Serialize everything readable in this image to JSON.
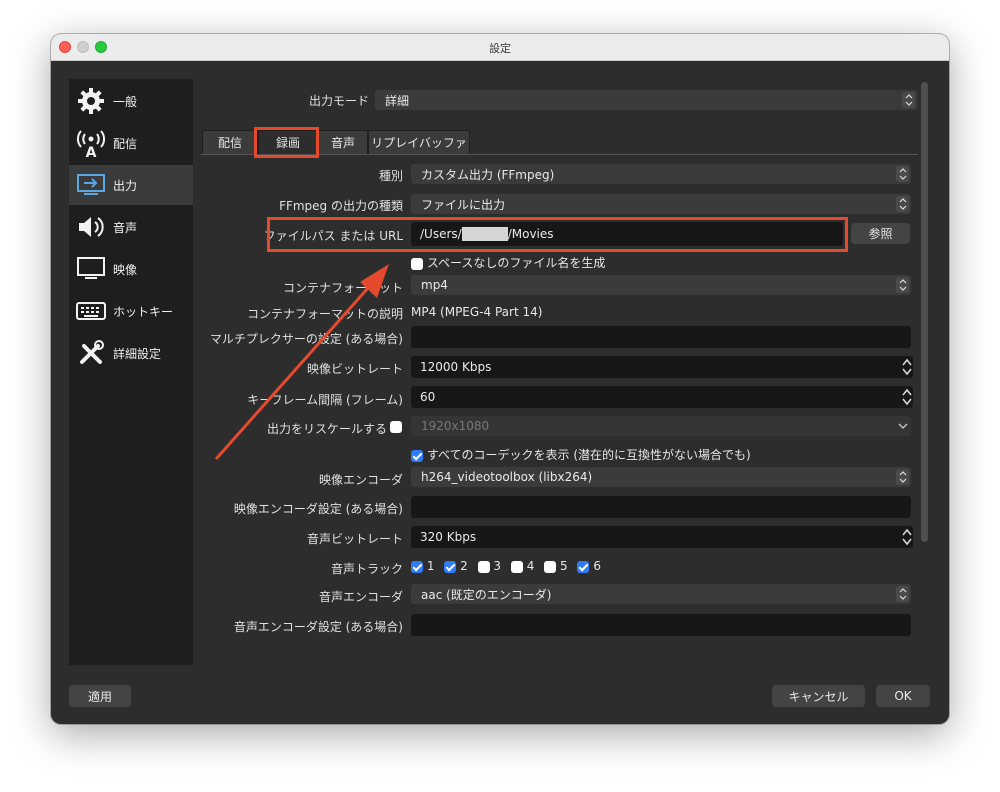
{
  "window": {
    "title": "設定"
  },
  "sidebar": {
    "items": [
      {
        "label": "一般",
        "icon": "gear-icon"
      },
      {
        "label": "配信",
        "icon": "antenna-icon"
      },
      {
        "label": "出力",
        "icon": "output-icon"
      },
      {
        "label": "音声",
        "icon": "speaker-icon"
      },
      {
        "label": "映像",
        "icon": "monitor-icon"
      },
      {
        "label": "ホットキー",
        "icon": "keyboard-icon"
      },
      {
        "label": "詳細設定",
        "icon": "tools-icon"
      }
    ],
    "active_index": 2
  },
  "output_mode": {
    "label": "出力モード",
    "value": "詳細"
  },
  "tabs": [
    "配信",
    "録画",
    "音声",
    "リプレイバッファ"
  ],
  "active_tab": "録画",
  "form": {
    "type": {
      "label": "種別",
      "value": "カスタム出力 (FFmpeg)"
    },
    "ffmpeg_output_type": {
      "label": "FFmpeg の出力の種類",
      "value": "ファイルに出力"
    },
    "file_path": {
      "label": "ファイルパス または URL",
      "value_prefix": "/Users/",
      "value_suffix": "/Movies",
      "browse": "参照"
    },
    "no_space_filename": {
      "label": "スペースなしのファイル名を生成",
      "checked": false
    },
    "container_format": {
      "label": "コンテナフォーマット",
      "value": "mp4"
    },
    "container_desc": {
      "label": "コンテナフォーマットの説明",
      "value": "MP4 (MPEG-4 Part 14)"
    },
    "muxer_settings": {
      "label": "マルチプレクサーの設定 (ある場合)",
      "value": ""
    },
    "video_bitrate": {
      "label": "映像ビットレート",
      "value": "12000 Kbps"
    },
    "keyframe_interval": {
      "label": "キーフレーム間隔 (フレーム)",
      "value": "60"
    },
    "rescale": {
      "label": "出力をリスケールする",
      "checked": false,
      "value": "1920x1080"
    },
    "show_all_codecs": {
      "label": "すべてのコーデックを表示 (潜在的に互換性がない場合でも)",
      "checked": true
    },
    "video_encoder": {
      "label": "映像エンコーダ",
      "value": "h264_videotoolbox (libx264)"
    },
    "video_encoder_settings": {
      "label": "映像エンコーダ設定 (ある場合)",
      "value": ""
    },
    "audio_bitrate": {
      "label": "音声ビットレート",
      "value": "320 Kbps"
    },
    "audio_track": {
      "label": "音声トラック",
      "tracks": [
        {
          "n": "1",
          "checked": true
        },
        {
          "n": "2",
          "checked": true
        },
        {
          "n": "3",
          "checked": false
        },
        {
          "n": "4",
          "checked": false
        },
        {
          "n": "5",
          "checked": false
        },
        {
          "n": "6",
          "checked": true
        }
      ]
    },
    "audio_encoder": {
      "label": "音声エンコーダ",
      "value": "aac (既定のエンコーダ)"
    },
    "audio_encoder_settings": {
      "label": "音声エンコーダ設定 (ある場合)",
      "value": ""
    }
  },
  "buttons": {
    "apply": "適用",
    "cancel": "キャンセル",
    "ok": "OK"
  },
  "colors": {
    "annotation": "#e5492e",
    "checkbox_on": "#2f7cf6"
  }
}
